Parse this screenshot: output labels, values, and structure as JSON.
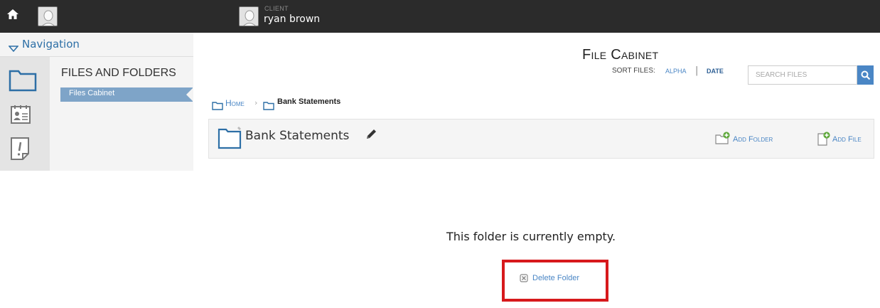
{
  "topbar": {
    "client_label": "CLIENT",
    "client_name": "ryan brown",
    "icons": [
      "home-icon",
      "user-avatar",
      "client-avatar"
    ]
  },
  "nav": {
    "header_label": "Navigation",
    "section_title": "FILES AND FOLDERS",
    "active_item": "Files Cabinet",
    "rail_icons": [
      "folder-icon",
      "contact-card-icon",
      "alert-note-icon"
    ]
  },
  "page": {
    "title": "File Cabinet",
    "sort_label": "SORT FILES:",
    "sort_alpha": "ALPHA",
    "sort_separator": "|",
    "sort_date": "DATE",
    "search_placeholder": "SEARCH FILES"
  },
  "breadcrumb": {
    "home": "Home",
    "separator": "›",
    "current": "Bank Statements"
  },
  "folder": {
    "name": "Bank Statements",
    "add_folder": "Add Folder",
    "add_file": "Add File"
  },
  "empty_state": {
    "message": "This folder is currently empty.",
    "delete_label": "Delete Folder"
  },
  "colors": {
    "topbar": "#2b2b2b",
    "link": "#4a86c5",
    "active_nav": "#7ea4c8",
    "highlight": "#d7191c"
  }
}
